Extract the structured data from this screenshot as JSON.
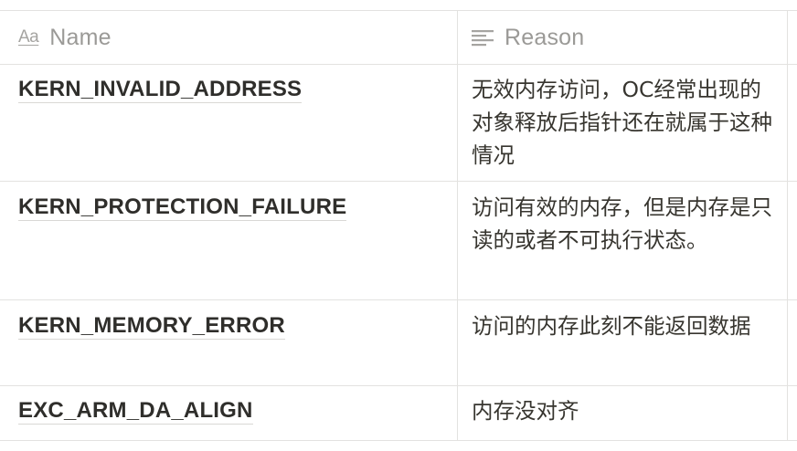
{
  "columns": {
    "name": {
      "label": "Name",
      "icon": "text-type-icon",
      "icon_glyph": "Aa"
    },
    "reason": {
      "label": "Reason",
      "icon": "text-lines-icon"
    }
  },
  "rows": [
    {
      "name": "KERN_INVALID_ADDRESS",
      "reason": "无效内存访问，OC经常出现的对象释放后指针还在就属于这种情况"
    },
    {
      "name": "KERN_PROTECTION_FAILURE",
      "reason": "访问有效的内存，但是内存是只读的或者不可执行状态。"
    },
    {
      "name": "KERN_MEMORY_ERROR",
      "reason": "访问的内存此刻不能返回数据"
    },
    {
      "name": "EXC_ARM_DA_ALIGN",
      "reason": "内存没对齐"
    }
  ]
}
